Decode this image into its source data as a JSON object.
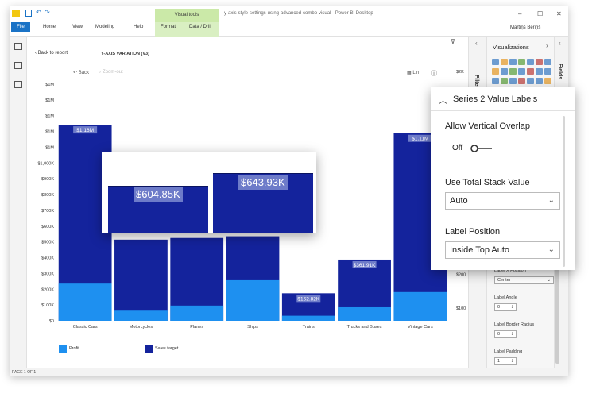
{
  "window": {
    "title": "y-axis-style-settings-using-advanced-combo-visual - Power BI Desktop",
    "user": "Mārtiņš Beriņš",
    "visual_tools": "Visual tools"
  },
  "ribbon": {
    "tabs": [
      "File",
      "Home",
      "View",
      "Modeling",
      "Help",
      "Format",
      "Data / Drill"
    ]
  },
  "report": {
    "back_to_report": "Back to report",
    "visual_title": "Y-AXIS VARIATION (V3)",
    "back": "Back",
    "zoom_out": "Zoom-out",
    "lin": "Lin"
  },
  "status": {
    "page": "PAGE 1 OF 1"
  },
  "panes": {
    "filters": "Filters",
    "visualizations": "Visualizations",
    "fields": "Fields"
  },
  "format_pane": {
    "label_x_position_label": "Label X Position",
    "label_x_position_value": "Center",
    "label_angle_label": "Label Angle",
    "label_angle_value": "0",
    "label_border_radius_label": "Label Border Radius",
    "label_border_radius_value": "0",
    "label_padding_label": "Label Padding",
    "label_padding_value": "1"
  },
  "popup_panel": {
    "title": "Series 2 Value Labels",
    "allow_overlap_label": "Allow Vertical Overlap",
    "allow_overlap_state": "Off",
    "total_stack_label": "Use Total Stack Value",
    "total_stack_value": "Auto",
    "label_position_label": "Label Position",
    "label_position_value": "Inside Top Auto"
  },
  "zoom_popup": {
    "labels": [
      "$604.85K",
      "$643.93K"
    ]
  },
  "colors": {
    "profit": "#1e90f0",
    "sales_target": "#14239c",
    "label_bg": "#6d7bc9",
    "visual_tools": "#cbe9a8",
    "file_tab": "#1a73c6"
  },
  "chart_data": {
    "type": "bar",
    "categories": [
      "Classic Cars",
      "Motorcycles",
      "Planes",
      "Ships",
      "Trains",
      "Trucks and Buses",
      "Vintage Cars"
    ],
    "series": [
      {
        "name": "Profit",
        "values": [
          220000,
          60000,
          90000,
          240000,
          30000,
          80000,
          170000
        ]
      },
      {
        "name": "Sales target",
        "values": [
          1160000,
          480000,
          490000,
          500000,
          162820,
          361910,
          1110000
        ]
      }
    ],
    "labels": [
      "$1.16M",
      "",
      "",
      "",
      "$162.82K",
      "$361.91K",
      "$1.11M"
    ],
    "y_ticks_left": [
      "$0",
      "$100K",
      "$200K",
      "$300K",
      "$400K",
      "$500K",
      "$600K",
      "$700K",
      "$800K",
      "$900K",
      "$1,000K",
      "$1M",
      "$1M",
      "$1M",
      "$1M",
      "$1M"
    ],
    "y_ticks_right": [
      "$100",
      "$200",
      "$300",
      "$400",
      "$2K",
      "$2K",
      "$2K",
      "$2K"
    ],
    "ylim": [
      0,
      1400000
    ],
    "legend": "bottom-left"
  }
}
